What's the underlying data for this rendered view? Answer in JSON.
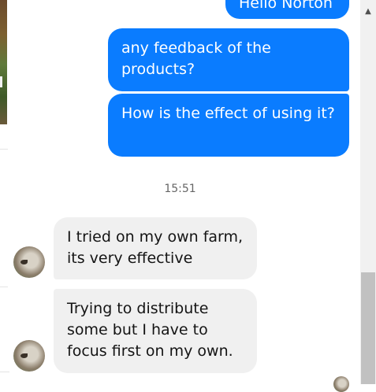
{
  "messages_out": [
    {
      "text": "Hello Norton"
    },
    {
      "text": "any feedback of the products?"
    },
    {
      "text": "How is the effect of using it?"
    }
  ],
  "timestamp": "15:51",
  "messages_in": [
    {
      "text": "I tried on my own farm, its very effective"
    },
    {
      "text": "Trying to distribute some but I have to focus first on my own."
    }
  ],
  "icons": {
    "scroll_up": "scroll-up-arrow-icon",
    "avatar": "contact-avatar"
  },
  "colors": {
    "outgoing_bubble": "#0a7cff",
    "incoming_bubble": "#f0f0f0",
    "timestamp_text": "#666666"
  }
}
